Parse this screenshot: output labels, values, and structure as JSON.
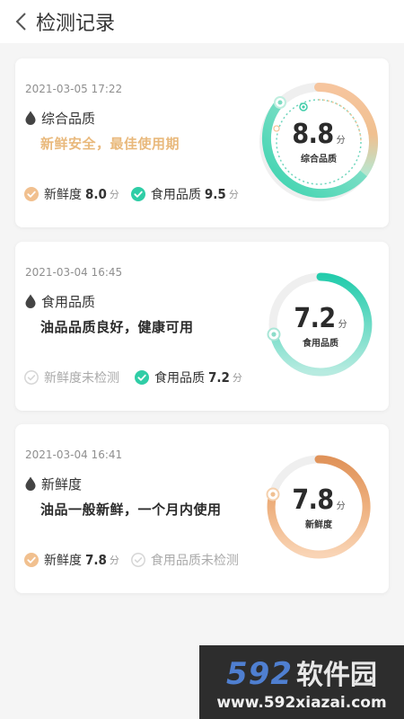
{
  "header": {
    "title": "检测记录"
  },
  "records": [
    {
      "date": "2021-03-05 17:22",
      "category": "综合品质",
      "description": "新鲜安全，最佳使用期",
      "description_color": "#e9b97c",
      "metric1": {
        "label": "新鲜度",
        "value": "8.0",
        "unit": "分"
      },
      "metric2": {
        "label": "食用品质",
        "value": "9.5",
        "unit": "分"
      },
      "gauge": {
        "score": "8.8",
        "unit": "分",
        "label": "综合品质"
      }
    },
    {
      "date": "2021-03-04 16:45",
      "category": "食用品质",
      "description": "油品品质良好，健康可用",
      "description_color": "#2a2a2a",
      "metric1": {
        "label": "新鲜度未检测"
      },
      "metric2": {
        "label": "食用品质",
        "value": "7.2",
        "unit": "分"
      },
      "gauge": {
        "score": "7.2",
        "unit": "分",
        "label": "食用品质"
      }
    },
    {
      "date": "2021-03-04 16:41",
      "category": "新鲜度",
      "description": "油品一般新鲜，一个月内使用",
      "description_color": "#2a2a2a",
      "metric1": {
        "label": "新鲜度",
        "value": "7.8",
        "unit": "分"
      },
      "metric2": {
        "label": "食用品质未检测"
      },
      "gauge": {
        "score": "7.8",
        "unit": "分",
        "label": "新鲜度"
      }
    }
  ],
  "colors": {
    "freshness_accent": "#f1c08f",
    "quality_accent": "#2fcda6",
    "inactive": "#d6d6d6"
  },
  "icons": {
    "back": "chevron-left-icon",
    "category": "oil-drop-icon",
    "checked": "check-circle-icon",
    "unchecked": "check-circle-outline-icon"
  },
  "watermark": {
    "logo_number": "592",
    "logo_text": "软件园",
    "url": "www.592xiazai.com"
  }
}
